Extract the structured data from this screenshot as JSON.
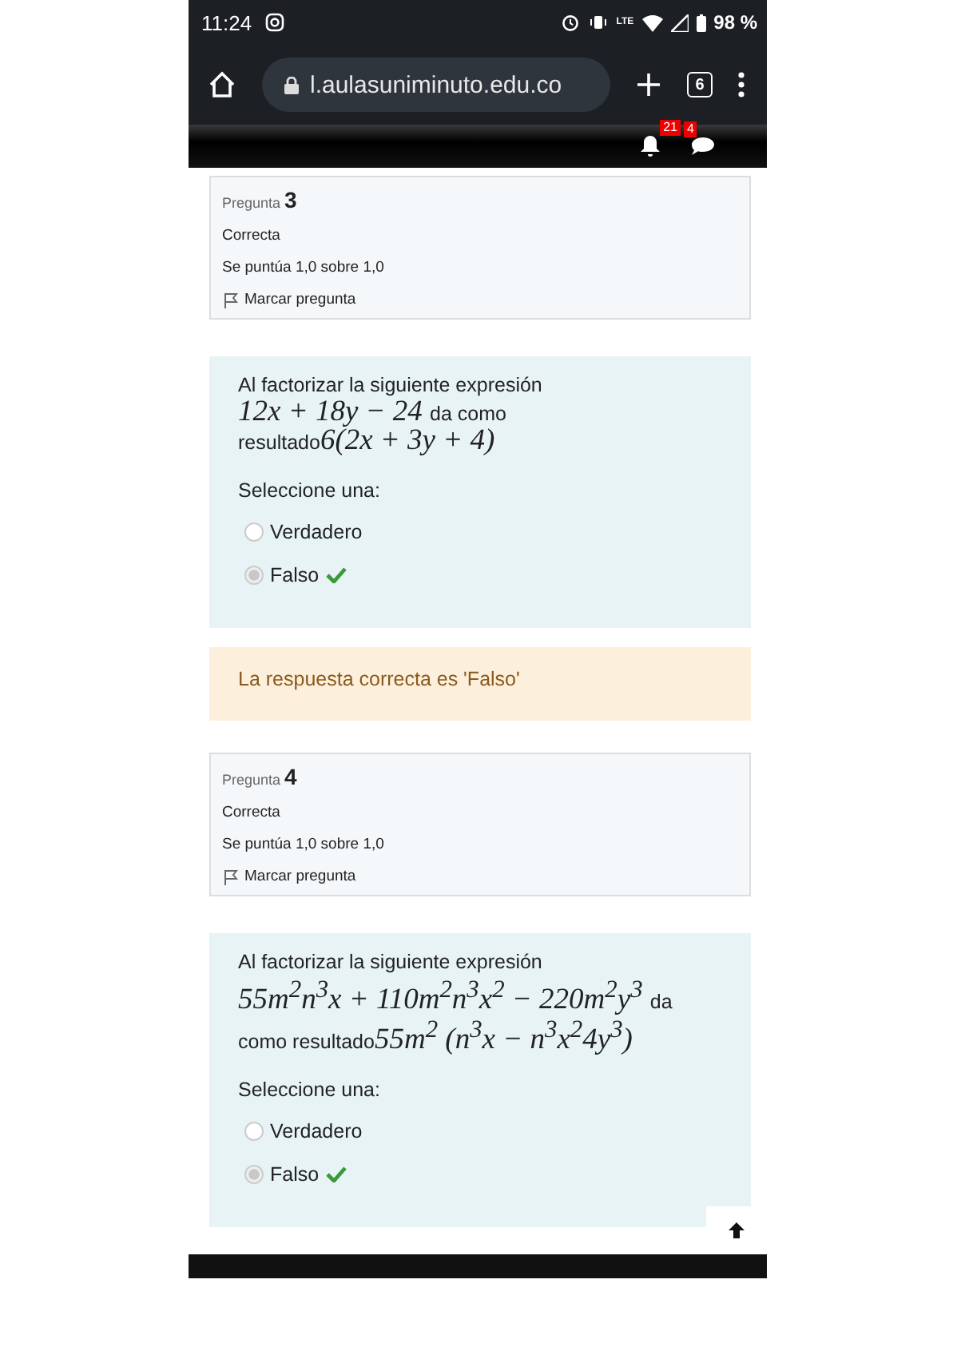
{
  "status_bar": {
    "time": "11:24",
    "network": "LTE",
    "battery": "98 %"
  },
  "browser": {
    "url": "l.aulasuniminuto.edu.co",
    "tab_count": "6"
  },
  "navbar": {
    "notifications": "21",
    "messages": "4"
  },
  "questions": [
    {
      "label": "Pregunta",
      "number": "3",
      "state": "Correcta",
      "grade": "Se puntúa 1,0 sobre 1,0",
      "flag": "Marcar pregunta",
      "segments": [
        {
          "kind": "text",
          "text": "Al factorizar la siguiente expresión"
        },
        {
          "kind": "math",
          "text": "12x + 18y − 24"
        },
        {
          "kind": "text",
          "text": "da como resultado"
        },
        {
          "kind": "math",
          "text": "6(2x + 3y + 4)"
        }
      ],
      "prompt": "Seleccione una:",
      "options": [
        {
          "label": "Verdadero",
          "selected": false,
          "correct": false
        },
        {
          "label": "Falso",
          "selected": true,
          "correct": true
        }
      ],
      "feedback": "La respuesta correcta es 'Falso'"
    },
    {
      "label": "Pregunta",
      "number": "4",
      "state": "Correcta",
      "grade": "Se puntúa 1,0 sobre 1,0",
      "flag": "Marcar pregunta",
      "segments": [
        {
          "kind": "text",
          "text": "Al factorizar la siguiente expresión"
        },
        {
          "kind": "math",
          "text": "55m$^{2}$n$^{3}$x + 110m$^{2}$n$^{3}$x$^{2}$ − 220m$^{2}$y$^{3}$"
        },
        {
          "kind": "text",
          "text": "da como resultado"
        },
        {
          "kind": "math",
          "text": "55m$^{2}$ (n$^{3}$x − n$^{3}$x$^{2}$4y$^{3}$)"
        }
      ],
      "prompt": "Seleccione una:",
      "options": [
        {
          "label": "Verdadero",
          "selected": false,
          "correct": false
        },
        {
          "label": "Falso",
          "selected": true,
          "correct": true
        }
      ]
    }
  ]
}
